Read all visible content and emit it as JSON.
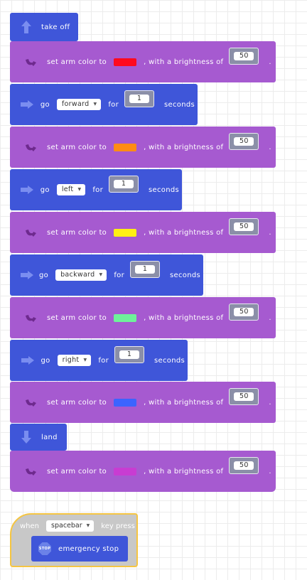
{
  "colors": {
    "blue_block": "#3f56d9",
    "purple_block": "#a65ad0",
    "event_outline": "#f5c542"
  },
  "program": {
    "take_off": {
      "label": "take off",
      "icon": "arrow-up-icon"
    },
    "arm_label": "set arm color to",
    "brightness_label": ", with a brightness of",
    "end_dot": ".",
    "go_label": "go",
    "for_label": "for",
    "seconds_label": "seconds",
    "arm_blocks": [
      {
        "color": "#ff0a1e",
        "brightness": "50"
      },
      {
        "color": "#ff8c14",
        "brightness": "50"
      },
      {
        "color": "#ffef14",
        "brightness": "50"
      },
      {
        "color": "#6ef29a",
        "brightness": "50"
      },
      {
        "color": "#3c64ff",
        "brightness": "50"
      },
      {
        "color": "#c83cd2",
        "brightness": "50"
      }
    ],
    "move_blocks": [
      {
        "direction": "forward",
        "duration": "1"
      },
      {
        "direction": "left",
        "duration": "1"
      },
      {
        "direction": "backward",
        "duration": "1"
      },
      {
        "direction": "right",
        "duration": "1"
      }
    ],
    "land": {
      "label": "land",
      "icon": "arrow-down-icon"
    }
  },
  "event_block": {
    "when_label": "when",
    "key": "spacebar",
    "key_press_label": "key press",
    "action_label": "emergency stop",
    "stop_icon_text": "STOP"
  }
}
